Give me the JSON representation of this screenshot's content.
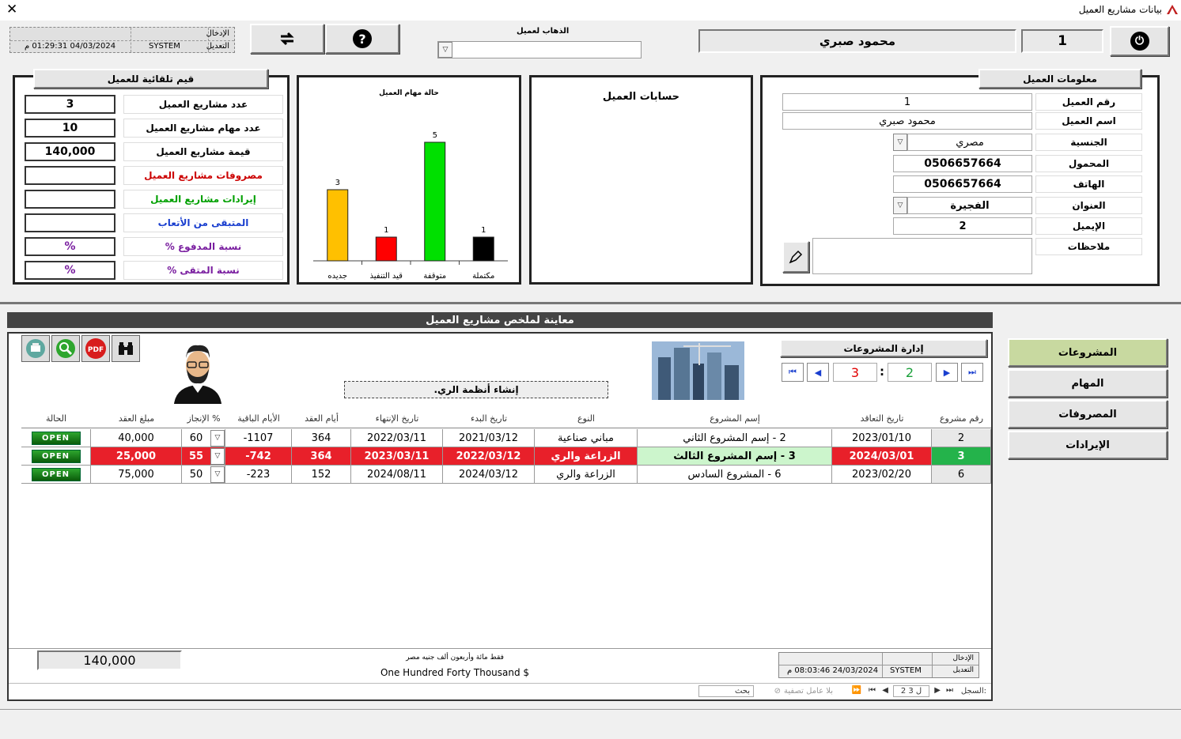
{
  "window": {
    "title": "بيانات مشاريع العميل"
  },
  "header": {
    "audit": {
      "entry_label": "الإدخال",
      "edit_label": "التعديل",
      "user": "SYSTEM",
      "datetime": "04/03/2024 01:29:31 م"
    },
    "goto_label": "الذهاب لعميل",
    "client_name": "محمود صبري",
    "client_no": "1"
  },
  "client_info": {
    "title": "معلومات العميل",
    "labels": {
      "number": "رقم العميل",
      "name": "اسم العميل",
      "nationality": "الجنسية",
      "mobile": "المحمول",
      "phone": "الهاتف",
      "address": "العنوان",
      "email": "الإيميل",
      "notes": "ملاحظات"
    },
    "values": {
      "number": "1",
      "name": "محمود صبري",
      "nationality": "مصري",
      "mobile": "0506657664",
      "phone": "0506657664",
      "address": "الفجيرة",
      "email": "2"
    }
  },
  "accounts": {
    "title": "حسابات العميل"
  },
  "chart_data": {
    "type": "bar",
    "title": "حالة مهام العميل",
    "categories": [
      "جديده",
      "قيد التنفيذ",
      "متوقفة",
      "مكتملة"
    ],
    "values": [
      3,
      1,
      5,
      1
    ],
    "colors": [
      "#ffc000",
      "#ff0000",
      "#00e000",
      "#000000"
    ],
    "ylim": [
      0,
      6
    ],
    "grid": false
  },
  "auto_values": {
    "title": "قيم تلقائية للعميل",
    "items": [
      {
        "label": "عدد مشاريع العميل",
        "value": "3",
        "color": "#000000"
      },
      {
        "label": "عدد مهام مشاريع العميل",
        "value": "10",
        "color": "#000000"
      },
      {
        "label": "قيمة مشاريع العميل",
        "value": "140,000",
        "color": "#000000"
      },
      {
        "label": "مصروفات مشاريع العميل",
        "value": "",
        "color": "#cc0000"
      },
      {
        "label": "إيرادات مشاريع العميل",
        "value": "",
        "color": "#00a000"
      },
      {
        "label": "المتبقى من الأتعاب",
        "value": "",
        "color": "#1a3fcf"
      },
      {
        "label": "نسبة المدفوع  %",
        "value": "%",
        "color": "#7a1fa0"
      },
      {
        "label": "نسبة المتقى  %",
        "value": "%",
        "color": "#7a1fa0"
      }
    ]
  },
  "summary": {
    "title": "معاينة لملخص مشاريع العميل",
    "project_mgmt_label": "إدارة المشروعات",
    "current_record": "2",
    "total_records": "3",
    "current_project_name": "إنشاء أنظمة الري.",
    "columns": [
      "رقم مشروع",
      "تاريخ التعاقد",
      "إسم المشروع",
      "النوع",
      "تاريخ البدء",
      "تاريخ الإنتهاء",
      "أيام العقد",
      "الأيام الباقية",
      "الإنجاز %",
      "مبلغ العقد",
      "الحالة"
    ],
    "rows": [
      {
        "no": "2",
        "contract_date": "2023/01/10",
        "name": "2 - إسم المشروع الثاني",
        "type": "مباني صناعية",
        "start": "2021/03/12",
        "end": "2022/03/11",
        "days": "364",
        "remaining": "-1107",
        "progress": "60",
        "amount": "40,000",
        "status": "OPEN"
      },
      {
        "no": "3",
        "contract_date": "2024/03/01",
        "name": "3 - إسم المشروع الثالث",
        "type": "الزراعة والري",
        "start": "2022/03/12",
        "end": "2023/03/11",
        "days": "364",
        "remaining": "-742",
        "progress": "55",
        "amount": "25,000",
        "status": "OPEN"
      },
      {
        "no": "6",
        "contract_date": "2023/02/20",
        "name": "6 - المشروع السادس",
        "type": "الزراعة والري",
        "start": "2024/03/12",
        "end": "2024/08/11",
        "days": "152",
        "remaining": "-223",
        "progress": "50",
        "amount": "75,000",
        "status": "OPEN"
      }
    ],
    "total": "140,000",
    "total_words_ar": "فقط مائة  وأربعون  ألف  جنيه مصر",
    "total_words_en": "One Hundred Forty Thousand $",
    "footer_audit": {
      "entry_label": "الإدخال",
      "edit_label": "التعديل",
      "user": "SYSTEM",
      "datetime": "24/03/2024 08:03:46 م"
    }
  },
  "side_buttons": [
    "المشروعات",
    "المهام",
    "المصروفات",
    "الإيرادات"
  ],
  "record_nav": {
    "label": "السجل:",
    "position": "2 ل 3",
    "filter": "بلا عامل تصفية",
    "search": "بحث"
  },
  "colors": {
    "accent_green": "#24b34b",
    "selected_red": "#e8202a",
    "side_active": "#c8d9a0"
  }
}
